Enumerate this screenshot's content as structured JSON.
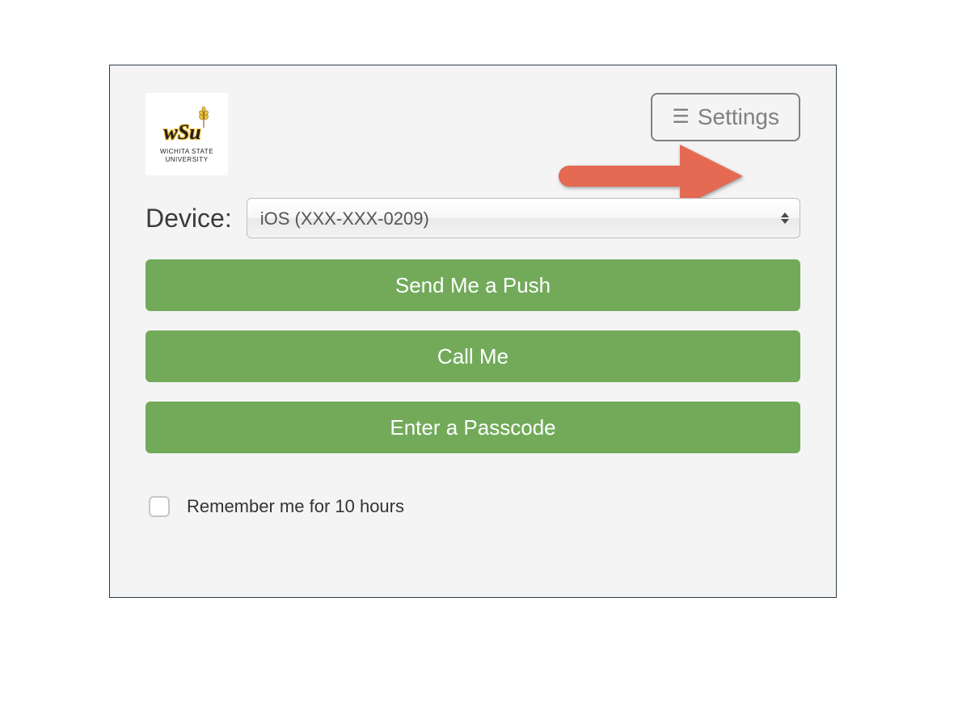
{
  "logo": {
    "wordmark": "wSu",
    "line1": "WICHITA STATE",
    "line2": "UNIVERSITY"
  },
  "settings": {
    "label": "Settings"
  },
  "device": {
    "label": "Device:",
    "selected": "iOS (XXX-XXX-0209)"
  },
  "actions": {
    "push": "Send Me a Push",
    "call": "Call Me",
    "passcode": "Enter a Passcode"
  },
  "remember": {
    "label": "Remember me for 10 hours",
    "checked": false
  },
  "colors": {
    "panel_border": "#2a3a47",
    "panel_bg": "#f4f4f4",
    "button_green": "#72aa5a",
    "arrow": "#e46a53",
    "settings_gray": "#808080"
  }
}
